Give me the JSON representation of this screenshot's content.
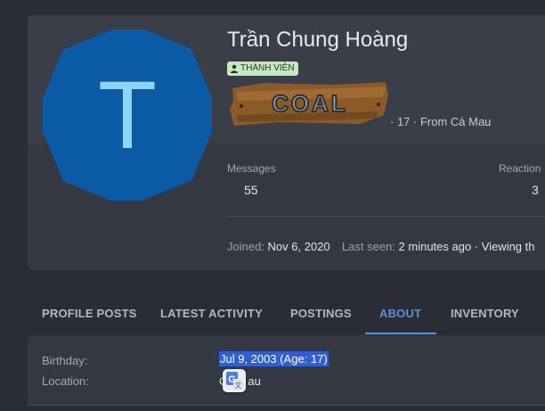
{
  "profile": {
    "avatar_letter": "T",
    "avatar_color": "#0b5aa6",
    "avatar_letter_color": "#8fd3f5",
    "name": "Trần Chung Hoàng",
    "badge": {
      "icon": "user-icon",
      "label": "THÀNH VIÊN"
    },
    "rank_banner": "COAL",
    "meta_line": "· 17 · From Cà Mau"
  },
  "stats": [
    {
      "label": "Messages",
      "value": "55"
    },
    {
      "label": "Reaction",
      "value": "3"
    }
  ],
  "activity": {
    "joined_label": "Joined:",
    "joined_value": "Nov 6, 2020",
    "last_seen_label": "Last seen:",
    "last_seen_value": "2 minutes ago · Viewing th"
  },
  "tabs": [
    {
      "label": "PROFILE POSTS",
      "active": false
    },
    {
      "label": "LATEST ACTIVITY",
      "active": false
    },
    {
      "label": "POSTINGS",
      "active": false
    },
    {
      "label": "ABOUT",
      "active": true
    },
    {
      "label": "INVENTORY",
      "active": false
    }
  ],
  "about": {
    "birthday_label": "Birthday:",
    "birthday_value": "Jul 9, 2003 (Age: 17)",
    "location_label": "Location:",
    "location_value_prefix": "C",
    "location_value_suffix": "au"
  },
  "colors": {
    "accent": "#5b8fe0",
    "selection": "#2d5fcf",
    "badge_bg": "#c8e8c3"
  },
  "icons": {
    "translate": "google-translate-icon"
  }
}
